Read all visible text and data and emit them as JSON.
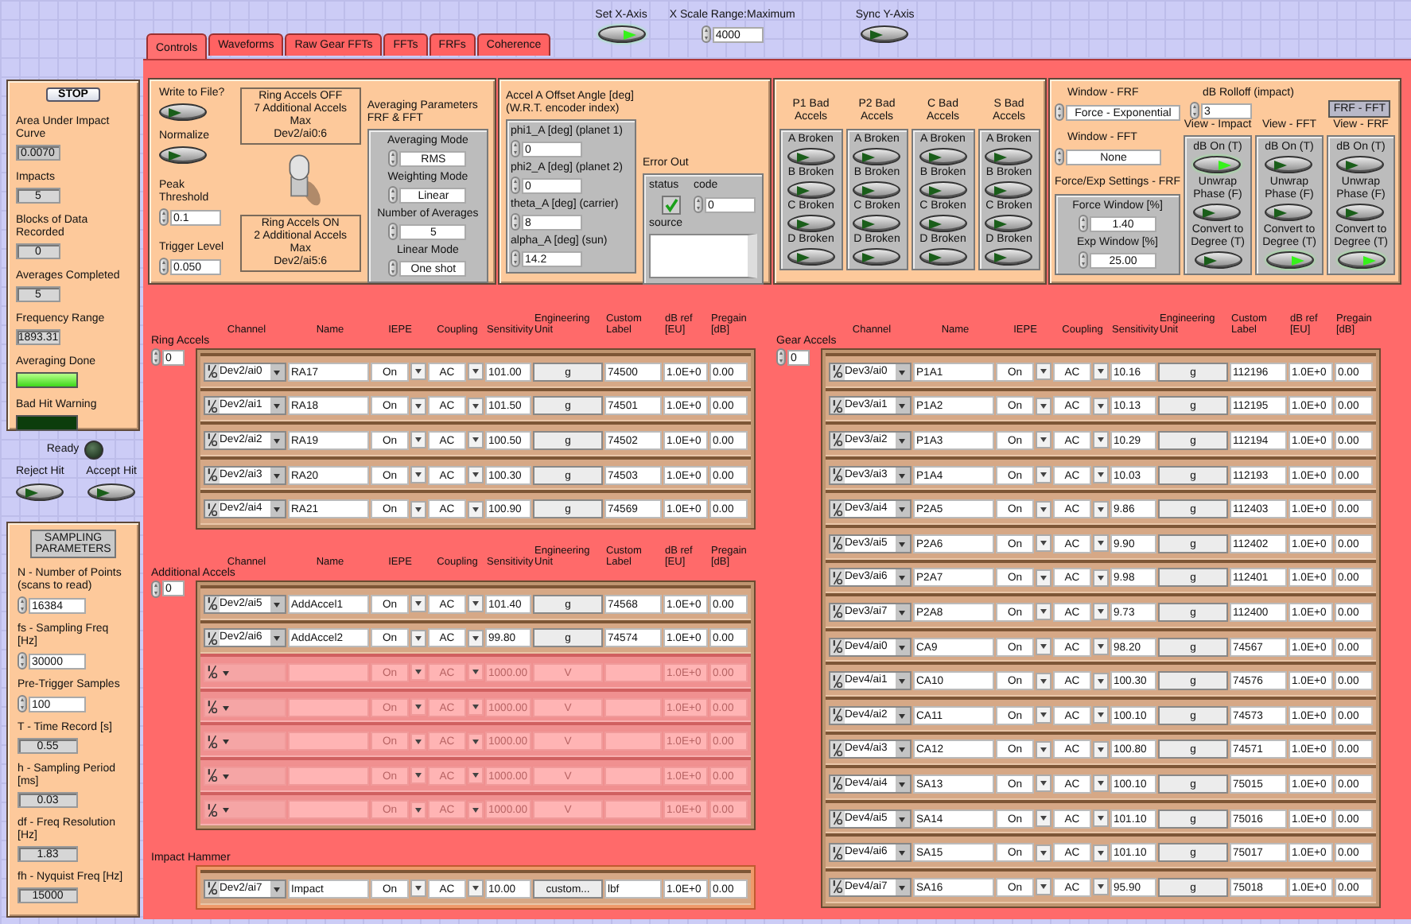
{
  "top_controls": {
    "set_x_axis": {
      "label": "Set X-Axis",
      "on": true
    },
    "x_scale": {
      "label": "X Scale Range:Maximum",
      "value": "4000"
    },
    "sync_y_axis": {
      "label": "Sync Y-Axis",
      "on": false
    }
  },
  "tabs": [
    {
      "label": "Controls",
      "selected": true
    },
    {
      "label": "Waveforms",
      "selected": false
    },
    {
      "label": "Raw Gear FFTs",
      "selected": false
    },
    {
      "label": "FFTs",
      "selected": false
    },
    {
      "label": "FRFs",
      "selected": false
    },
    {
      "label": "Coherence",
      "selected": false
    }
  ],
  "status_panel": {
    "stop_label": "STOP",
    "indicators": [
      {
        "kind": "numeric",
        "label": "Area Under Impact Curve",
        "value": "0.0070"
      },
      {
        "kind": "numeric",
        "label": "Impacts",
        "value": "5"
      },
      {
        "kind": "numeric",
        "label": "Blocks of Data Recorded",
        "value": "0"
      },
      {
        "kind": "numeric",
        "label": "Averages Completed",
        "value": "5"
      },
      {
        "kind": "numeric",
        "label": "Frequency Range",
        "value": "1893.31"
      },
      {
        "kind": "led_bar",
        "label": "Averaging Done",
        "on": true
      },
      {
        "kind": "led_bar",
        "label": "Bad Hit Warning",
        "on": false
      }
    ]
  },
  "ready": {
    "label": "Ready",
    "on": false
  },
  "hit_buttons": [
    {
      "label": "Reject Hit",
      "on": false
    },
    {
      "label": "Accept Hit",
      "on": false
    }
  ],
  "sampling": {
    "title": "SAMPLING\nPARAMETERS",
    "fields": [
      {
        "kind": "control",
        "label": "N - Number of Points\n(scans to read)",
        "value": "16384"
      },
      {
        "kind": "control",
        "label": "fs - Sampling Freq [Hz]",
        "value": "30000"
      },
      {
        "kind": "control",
        "label": "Pre-Trigger Samples",
        "value": "100"
      },
      {
        "kind": "indicator",
        "label": "T - Time Record [s]",
        "value": "0.55"
      },
      {
        "kind": "indicator",
        "label": "h - Sampling Period [ms]",
        "value": "0.03"
      },
      {
        "kind": "indicator",
        "label": "df - Freq Resolution [Hz]",
        "value": "1.83"
      },
      {
        "kind": "indicator",
        "label": "fh - Nyquist Freq [Hz]",
        "value": "15000"
      }
    ]
  },
  "acquisition": {
    "buttons": [
      {
        "label": "Write to File?",
        "on": false
      },
      {
        "label": "Normalize",
        "on": false
      }
    ],
    "numerics": [
      {
        "label": "Peak Threshold",
        "value": "0.1"
      },
      {
        "label": "Trigger Level",
        "value": "0.050"
      }
    ],
    "ring_off_note": "Ring Accels OFF\n7 Additional Accels Max\nDev2/ai0:6",
    "switch_on": false,
    "ring_on_note": "Ring Accels ON\n2 Additional Accels Max\nDev2/ai5:6"
  },
  "averaging": {
    "title": "Averaging Parameters\nFRF & FFT",
    "fields": [
      {
        "label": "Averaging Mode",
        "value": "RMS"
      },
      {
        "label": "Weighting Mode",
        "value": "Linear"
      },
      {
        "label": "Number of Averages",
        "value": "5"
      },
      {
        "label": "Linear Mode",
        "value": "One shot"
      }
    ]
  },
  "offset": {
    "title": "Accel A Offset Angle [deg]\n(W.R.T. encoder index)",
    "fields": [
      {
        "label": "phi1_A [deg] (planet 1)",
        "value": "0"
      },
      {
        "label": "phi2_A [deg] (planet 2)",
        "value": "0"
      },
      {
        "label": "theta_A [deg] (carrier)",
        "value": "8"
      },
      {
        "label": "alpha_A [deg] (sun)",
        "value": "14.2"
      }
    ]
  },
  "error_out": {
    "title": "Error Out",
    "status_label": "status",
    "status_ok": true,
    "code_label": "code",
    "code": "0",
    "source_label": "source"
  },
  "bad_accels": [
    {
      "title": "P1 Bad Accels",
      "buttons": [
        {
          "label": "A Broken",
          "on": false
        },
        {
          "label": "B Broken",
          "on": false
        },
        {
          "label": "C Broken",
          "on": false
        },
        {
          "label": "D Broken",
          "on": false
        }
      ]
    },
    {
      "title": "P2 Bad Accels",
      "buttons": [
        {
          "label": "A Broken",
          "on": false
        },
        {
          "label": "B Broken",
          "on": false
        },
        {
          "label": "C Broken",
          "on": false
        },
        {
          "label": "D Broken",
          "on": false
        }
      ]
    },
    {
      "title": "C Bad Accels",
      "buttons": [
        {
          "label": "A Broken",
          "on": false
        },
        {
          "label": "B Broken",
          "on": false
        },
        {
          "label": "C Broken",
          "on": false
        },
        {
          "label": "D Broken",
          "on": false
        }
      ]
    },
    {
      "title": "S Bad Accels",
      "buttons": [
        {
          "label": "A Broken",
          "on": false
        },
        {
          "label": "B Broken",
          "on": false
        },
        {
          "label": "C Broken",
          "on": false
        },
        {
          "label": "D Broken",
          "on": false
        }
      ]
    }
  ],
  "windows": {
    "frf_window": {
      "label": "Window - FRF",
      "value": "Force - Exponential"
    },
    "fft_window": {
      "label": "Window - FFT",
      "value": "None"
    },
    "force_exp": {
      "title": "Force/Exp Settings - FRF",
      "fields": [
        {
          "label": "Force Window [%]",
          "value": "1.40"
        },
        {
          "label": "Exp Window [%]",
          "value": "25.00"
        }
      ]
    },
    "rolloff": {
      "label": "dB Rolloff (impact)",
      "value": "3"
    },
    "mode_label": "FRF - FFT",
    "views": [
      {
        "title": "View - Impact",
        "buttons": [
          {
            "label": "dB On (T)",
            "on": true
          },
          {
            "label": "Unwrap\nPhase (F)",
            "on": false
          },
          {
            "label": "Convert to\nDegree (T)",
            "on": false
          }
        ]
      },
      {
        "title": "View - FFT",
        "buttons": [
          {
            "label": "dB On (T)",
            "on": false
          },
          {
            "label": "Unwrap\nPhase (F)",
            "on": false
          },
          {
            "label": "Convert to\nDegree (T)",
            "on": true
          }
        ]
      },
      {
        "title": "View - FRF",
        "buttons": [
          {
            "label": "dB On (T)",
            "on": false
          },
          {
            "label": "Unwrap\nPhase (F)",
            "on": false
          },
          {
            "label": "Convert to\nDegree (T)",
            "on": true
          }
        ]
      }
    ]
  },
  "tables": [
    {
      "title": "Ring Accels",
      "index": "0",
      "columns": [
        "Channel",
        "Name",
        "IEPE",
        "Coupling",
        "Sensitivity",
        "Engineering Unit",
        "Custom Label",
        "dB ref [EU]",
        "Pregain [dB]"
      ],
      "rows": [
        {
          "channel": "Dev2/ai0",
          "name": "RA17",
          "iepe": "On",
          "coupling": "AC",
          "sensitivity": "101.00",
          "unit": "g",
          "label": "74500",
          "db_ref": "1.0E+0",
          "pregain": "0.00",
          "disabled": false
        },
        {
          "channel": "Dev2/ai1",
          "name": "RA18",
          "iepe": "On",
          "coupling": "AC",
          "sensitivity": "101.50",
          "unit": "g",
          "label": "74501",
          "db_ref": "1.0E+0",
          "pregain": "0.00",
          "disabled": false
        },
        {
          "channel": "Dev2/ai2",
          "name": "RA19",
          "iepe": "On",
          "coupling": "AC",
          "sensitivity": "100.50",
          "unit": "g",
          "label": "74502",
          "db_ref": "1.0E+0",
          "pregain": "0.00",
          "disabled": false
        },
        {
          "channel": "Dev2/ai3",
          "name": "RA20",
          "iepe": "On",
          "coupling": "AC",
          "sensitivity": "100.30",
          "unit": "g",
          "label": "74503",
          "db_ref": "1.0E+0",
          "pregain": "0.00",
          "disabled": false
        },
        {
          "channel": "Dev2/ai4",
          "name": "RA21",
          "iepe": "On",
          "coupling": "AC",
          "sensitivity": "100.90",
          "unit": "g",
          "label": "74569",
          "db_ref": "1.0E+0",
          "pregain": "0.00",
          "disabled": false
        }
      ]
    },
    {
      "title": "Additional Accels",
      "index": "0",
      "columns": [
        "Channel",
        "Name",
        "IEPE",
        "Coupling",
        "Sensitivity",
        "Engineering Unit",
        "Custom Label",
        "dB ref [EU]",
        "Pregain [dB]"
      ],
      "rows": [
        {
          "channel": "Dev2/ai5",
          "name": "AddAccel1",
          "iepe": "On",
          "coupling": "AC",
          "sensitivity": "101.40",
          "unit": "g",
          "label": "74568",
          "db_ref": "1.0E+0",
          "pregain": "0.00",
          "disabled": false
        },
        {
          "channel": "Dev2/ai6",
          "name": "AddAccel2",
          "iepe": "On",
          "coupling": "AC",
          "sensitivity": "99.80",
          "unit": "g",
          "label": "74574",
          "db_ref": "1.0E+0",
          "pregain": "0.00",
          "disabled": false
        },
        {
          "iepe": "On",
          "coupling": "AC",
          "sensitivity": "1000.00",
          "unit": "V",
          "db_ref": "1.0E+0",
          "pregain": "0.00",
          "disabled": true
        },
        {
          "iepe": "On",
          "coupling": "AC",
          "sensitivity": "1000.00",
          "unit": "V",
          "db_ref": "1.0E+0",
          "pregain": "0.00",
          "disabled": true
        },
        {
          "iepe": "On",
          "coupling": "AC",
          "sensitivity": "1000.00",
          "unit": "V",
          "db_ref": "1.0E+0",
          "pregain": "0.00",
          "disabled": true
        },
        {
          "iepe": "On",
          "coupling": "AC",
          "sensitivity": "1000.00",
          "unit": "V",
          "db_ref": "1.0E+0",
          "pregain": "0.00",
          "disabled": true
        },
        {
          "iepe": "On",
          "coupling": "AC",
          "sensitivity": "1000.00",
          "unit": "V",
          "db_ref": "1.0E+0",
          "pregain": "0.00",
          "disabled": true
        }
      ]
    },
    {
      "title": "Impact Hammer",
      "rows": [
        {
          "channel": "Dev2/ai7",
          "name": "Impact",
          "iepe": "On",
          "coupling": "AC",
          "sensitivity": "10.00",
          "unit": "custom...",
          "label": "lbf",
          "db_ref": "1.0E+0",
          "pregain": "0.00",
          "disabled": false
        }
      ]
    },
    {
      "title": "Gear Accels",
      "index": "0",
      "columns": [
        "Channel",
        "Name",
        "IEPE",
        "Coupling",
        "Sensitivity",
        "Engineering Unit",
        "Custom Label",
        "dB ref [EU]",
        "Pregain [dB]"
      ],
      "rows": [
        {
          "channel": "Dev3/ai0",
          "name": "P1A1",
          "iepe": "On",
          "coupling": "AC",
          "sensitivity": "10.16",
          "unit": "g",
          "label": "112196",
          "db_ref": "1.0E+0",
          "pregain": "0.00",
          "disabled": false
        },
        {
          "channel": "Dev3/ai1",
          "name": "P1A2",
          "iepe": "On",
          "coupling": "AC",
          "sensitivity": "10.13",
          "unit": "g",
          "label": "112195",
          "db_ref": "1.0E+0",
          "pregain": "0.00",
          "disabled": false
        },
        {
          "channel": "Dev3/ai2",
          "name": "P1A3",
          "iepe": "On",
          "coupling": "AC",
          "sensitivity": "10.29",
          "unit": "g",
          "label": "112194",
          "db_ref": "1.0E+0",
          "pregain": "0.00",
          "disabled": false
        },
        {
          "channel": "Dev3/ai3",
          "name": "P1A4",
          "iepe": "On",
          "coupling": "AC",
          "sensitivity": "10.03",
          "unit": "g",
          "label": "112193",
          "db_ref": "1.0E+0",
          "pregain": "0.00",
          "disabled": false
        },
        {
          "channel": "Dev3/ai4",
          "name": "P2A5",
          "iepe": "On",
          "coupling": "AC",
          "sensitivity": "9.86",
          "unit": "g",
          "label": "112403",
          "db_ref": "1.0E+0",
          "pregain": "0.00",
          "disabled": false
        },
        {
          "channel": "Dev3/ai5",
          "name": "P2A6",
          "iepe": "On",
          "coupling": "AC",
          "sensitivity": "9.90",
          "unit": "g",
          "label": "112402",
          "db_ref": "1.0E+0",
          "pregain": "0.00",
          "disabled": false
        },
        {
          "channel": "Dev3/ai6",
          "name": "P2A7",
          "iepe": "On",
          "coupling": "AC",
          "sensitivity": "9.98",
          "unit": "g",
          "label": "112401",
          "db_ref": "1.0E+0",
          "pregain": "0.00",
          "disabled": false
        },
        {
          "channel": "Dev3/ai7",
          "name": "P2A8",
          "iepe": "On",
          "coupling": "AC",
          "sensitivity": "9.73",
          "unit": "g",
          "label": "112400",
          "db_ref": "1.0E+0",
          "pregain": "0.00",
          "disabled": false
        },
        {
          "channel": "Dev4/ai0",
          "name": "CA9",
          "iepe": "On",
          "coupling": "AC",
          "sensitivity": "98.20",
          "unit": "g",
          "label": "74567",
          "db_ref": "1.0E+0",
          "pregain": "0.00",
          "disabled": false
        },
        {
          "channel": "Dev4/ai1",
          "name": "CA10",
          "iepe": "On",
          "coupling": "AC",
          "sensitivity": "100.30",
          "unit": "g",
          "label": "74576",
          "db_ref": "1.0E+0",
          "pregain": "0.00",
          "disabled": false
        },
        {
          "channel": "Dev4/ai2",
          "name": "CA11",
          "iepe": "On",
          "coupling": "AC",
          "sensitivity": "100.10",
          "unit": "g",
          "label": "74573",
          "db_ref": "1.0E+0",
          "pregain": "0.00",
          "disabled": false
        },
        {
          "channel": "Dev4/ai3",
          "name": "CA12",
          "iepe": "On",
          "coupling": "AC",
          "sensitivity": "100.80",
          "unit": "g",
          "label": "74571",
          "db_ref": "1.0E+0",
          "pregain": "0.00",
          "disabled": false
        },
        {
          "channel": "Dev4/ai4",
          "name": "SA13",
          "iepe": "On",
          "coupling": "AC",
          "sensitivity": "100.10",
          "unit": "g",
          "label": "75015",
          "db_ref": "1.0E+0",
          "pregain": "0.00",
          "disabled": false
        },
        {
          "channel": "Dev4/ai5",
          "name": "SA14",
          "iepe": "On",
          "coupling": "AC",
          "sensitivity": "101.10",
          "unit": "g",
          "label": "75016",
          "db_ref": "1.0E+0",
          "pregain": "0.00",
          "disabled": false
        },
        {
          "channel": "Dev4/ai6",
          "name": "SA15",
          "iepe": "On",
          "coupling": "AC",
          "sensitivity": "101.10",
          "unit": "g",
          "label": "75017",
          "db_ref": "1.0E+0",
          "pregain": "0.00",
          "disabled": false
        },
        {
          "channel": "Dev4/ai7",
          "name": "SA16",
          "iepe": "On",
          "coupling": "AC",
          "sensitivity": "95.90",
          "unit": "g",
          "label": "75018",
          "db_ref": "1.0E+0",
          "pregain": "0.00",
          "disabled": false
        }
      ]
    }
  ]
}
